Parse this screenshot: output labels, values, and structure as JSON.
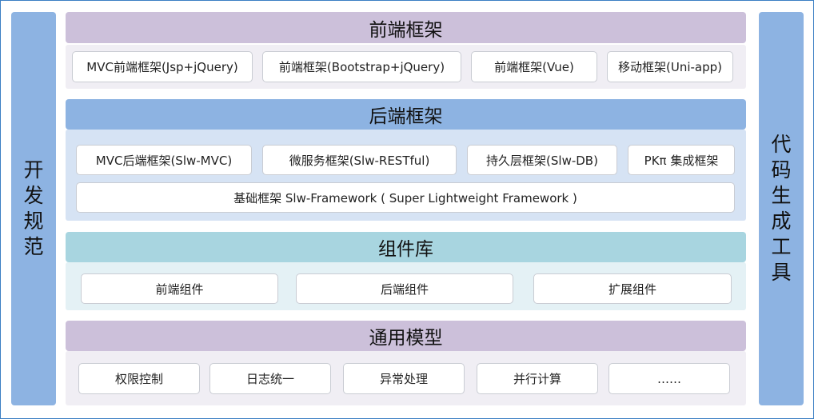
{
  "left_bar": {
    "label": "开发规范",
    "color": "#8db3e2"
  },
  "right_bar": {
    "label": "代码生成工具",
    "color": "#8db3e2"
  },
  "frontend": {
    "title": "前端框架",
    "title_color": "#ccc0da",
    "panel_color": "#f0eef4",
    "items": [
      "MVC前端框架(Jsp+jQuery)",
      "前端框架(Bootstrap+jQuery)",
      "前端框架(Vue)",
      "移动框架(Uni-app)"
    ]
  },
  "backend": {
    "title": "后端框架",
    "title_color": "#8db3e2",
    "panel_color": "#d6e3f4",
    "items": [
      "MVC后端框架(Slw-MVC)",
      "微服务框架(Slw-RESTful)",
      "持久层框架(Slw-DB)",
      "PKπ 集成框架"
    ],
    "base": "基础框架 Slw-Framework ( Super Lightweight Framework )"
  },
  "components": {
    "title": "组件库",
    "title_color": "#a8d5e0",
    "panel_color": "#e4f1f5",
    "items": [
      "前端组件",
      "后端组件",
      "扩展组件"
    ]
  },
  "common": {
    "title": "通用模型",
    "title_color": "#ccc0da",
    "panel_color": "#f0eef4",
    "items": [
      "权限控制",
      "日志统一",
      "异常处理",
      "并行计算",
      "……"
    ]
  }
}
